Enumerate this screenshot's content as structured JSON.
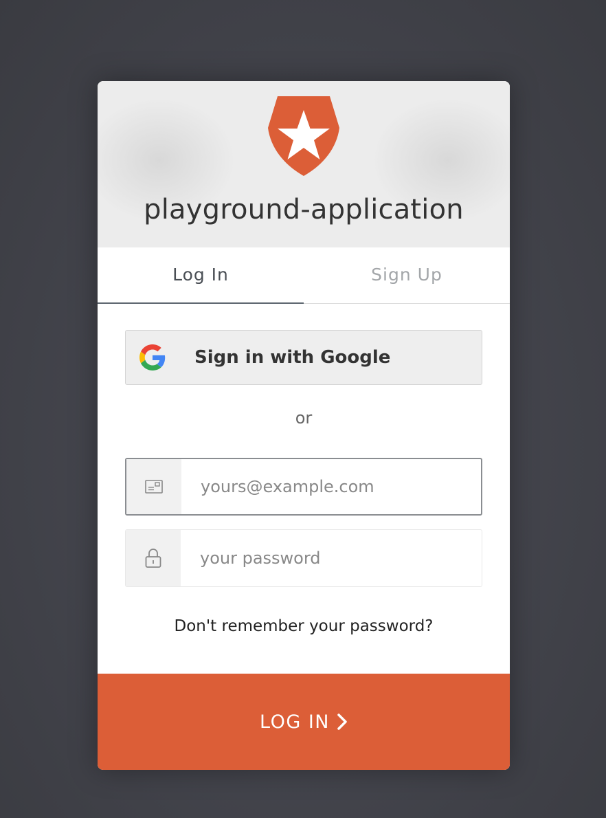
{
  "header": {
    "app_title": "playground-application"
  },
  "tabs": [
    {
      "label": "Log In",
      "active": true
    },
    {
      "label": "Sign Up",
      "active": false
    }
  ],
  "social": {
    "google_label": "Sign in with Google"
  },
  "separator": "or",
  "form": {
    "email_placeholder": "yours@example.com",
    "email_value": "",
    "password_placeholder": "your password",
    "password_value": ""
  },
  "forgot_password": "Don't remember your password?",
  "submit": {
    "label": "LOG IN"
  },
  "colors": {
    "brand": "#dc5e37",
    "background": "#44454d"
  },
  "icons": {
    "logo": "shield-star-icon",
    "google": "google-g-icon",
    "email": "envelope-icon",
    "password": "lock-icon",
    "submit": "chevron-right-icon"
  }
}
